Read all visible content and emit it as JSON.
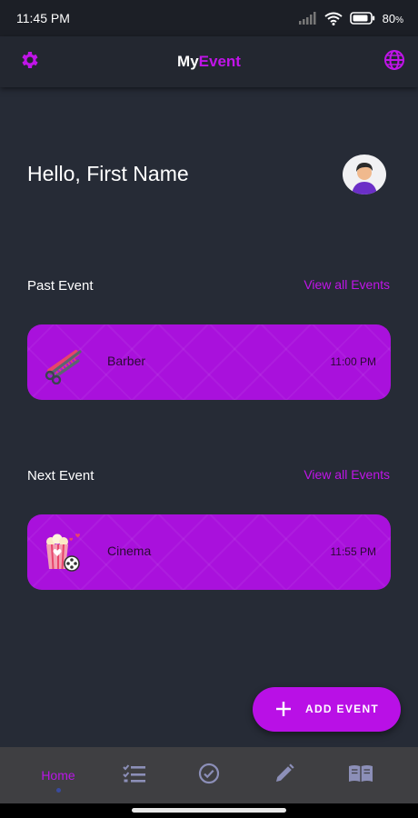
{
  "status_bar": {
    "time": "11:45 PM",
    "battery": "80",
    "battery_unit": "%"
  },
  "app_bar": {
    "title_part1": "My",
    "title_part2": "Event",
    "left_icon": "gear-icon",
    "right_icon": "globe-icon"
  },
  "greeting": "Hello, First Name",
  "past_section": {
    "title": "Past Event",
    "view_all": "View all Events",
    "event": {
      "name": "Barber",
      "time": "11:00 PM",
      "icon": "scissors-comb-icon"
    }
  },
  "next_section": {
    "title": "Next Event",
    "view_all": "View all Events",
    "event": {
      "name": "Cinema",
      "time": "11:55 PM",
      "icon": "popcorn-film-icon"
    }
  },
  "fab": {
    "label": "ADD EVENT",
    "icon": "plus-icon"
  },
  "bottom_nav": {
    "items": [
      {
        "label": "Home",
        "active": true
      },
      {
        "icon": "checklist-icon"
      },
      {
        "icon": "check-circle-icon"
      },
      {
        "icon": "pencil-icon"
      },
      {
        "icon": "book-icon"
      }
    ]
  },
  "colors": {
    "accent": "#c014e8",
    "card": "#a911dc",
    "background": "#262b36",
    "nav_background": "#3f3f42"
  }
}
